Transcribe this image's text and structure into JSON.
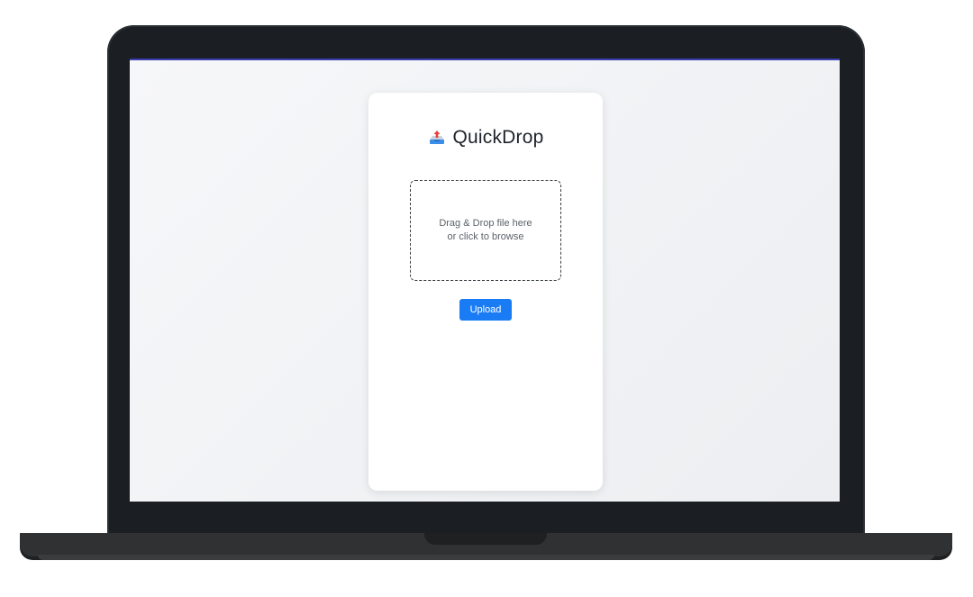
{
  "app": {
    "title": "QuickDrop",
    "logo_icon": "inbox-tray-upload-icon"
  },
  "dropzone": {
    "line1": "Drag & Drop file here",
    "line2": "or click to browse"
  },
  "actions": {
    "upload_label": "Upload"
  },
  "colors": {
    "accent": "#1a7cf5",
    "bezel": "#1b1f23",
    "card": "#ffffff"
  }
}
